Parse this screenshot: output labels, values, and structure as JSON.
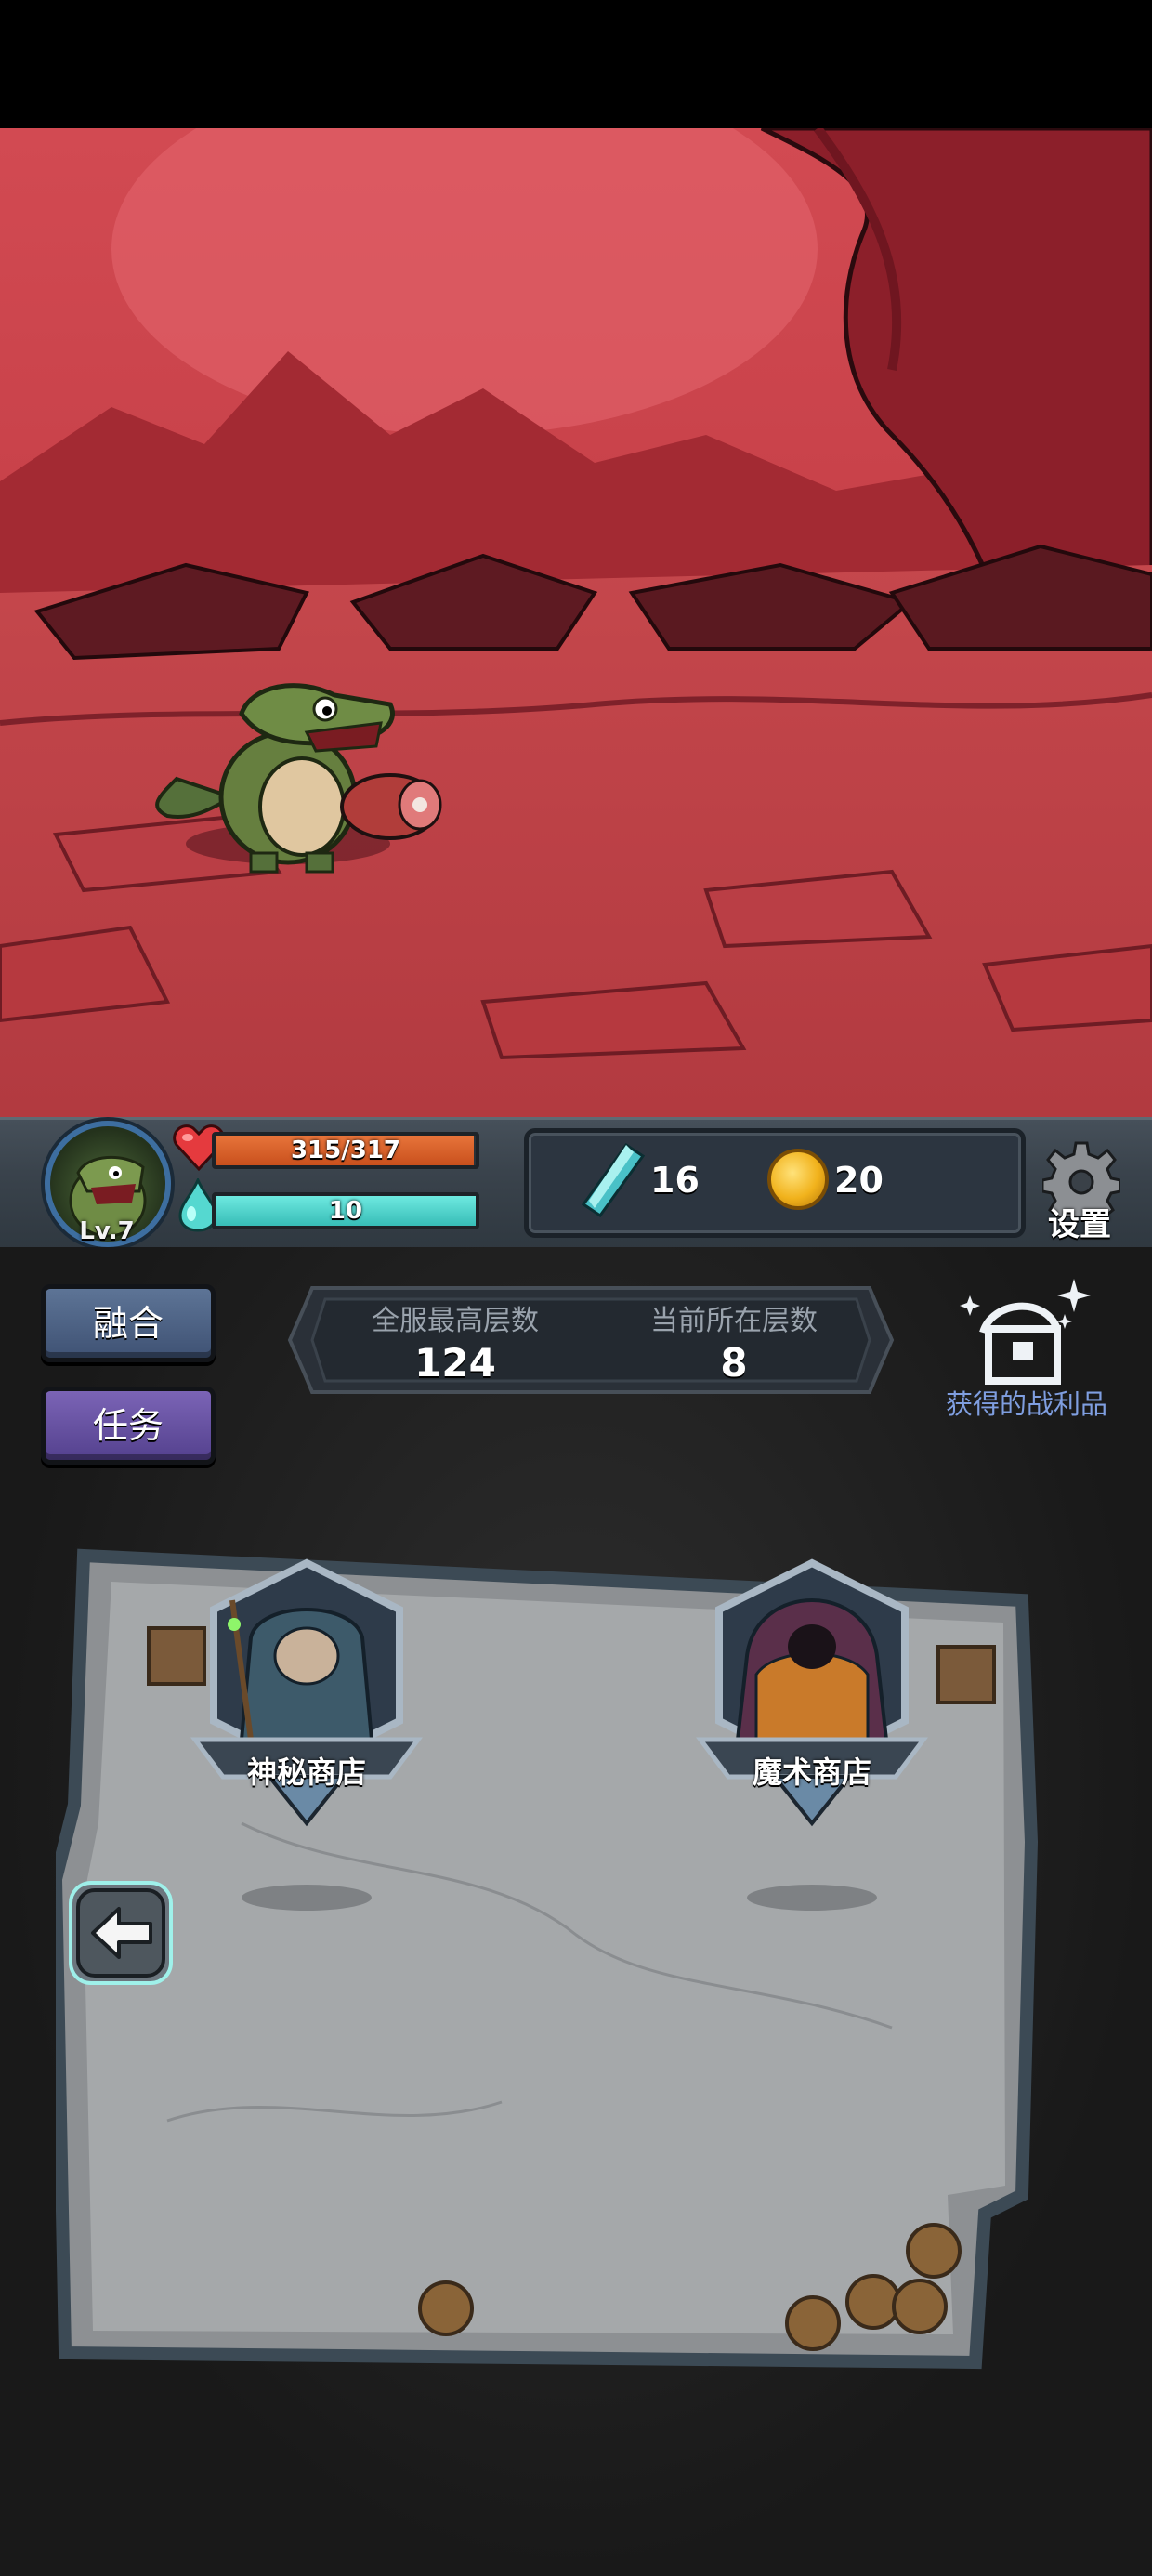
{
  "player": {
    "level": "Lv.7",
    "hp_text": "315/317",
    "hp_fraction": 0.994,
    "mp_text": "10",
    "mp_fraction": 1.0
  },
  "resources": {
    "gems": "16",
    "coins": "20",
    "gem_icon": "crystal-gem-icon",
    "coin_icon": "gold-coin-icon"
  },
  "settings": {
    "label": "设置",
    "icon": "gear-icon"
  },
  "side_buttons": {
    "fuse": "融合",
    "tasks": "任务"
  },
  "floor_info": {
    "server_best_label": "全服最高层数",
    "server_best_value": "124",
    "current_label": "当前所在层数",
    "current_value": "8"
  },
  "loot": {
    "label": "获得的战利品",
    "icon": "treasure-chest-icon"
  },
  "shops": [
    {
      "label": "神秘商店"
    },
    {
      "label": "魔术商店"
    }
  ],
  "colors": {
    "scene": "#c03a3e",
    "hp": "#d9622b",
    "mp": "#4fd6cf",
    "loot_text": "#7f9ee0",
    "fuse_button": "#4f6486",
    "task_button": "#664fa3"
  }
}
